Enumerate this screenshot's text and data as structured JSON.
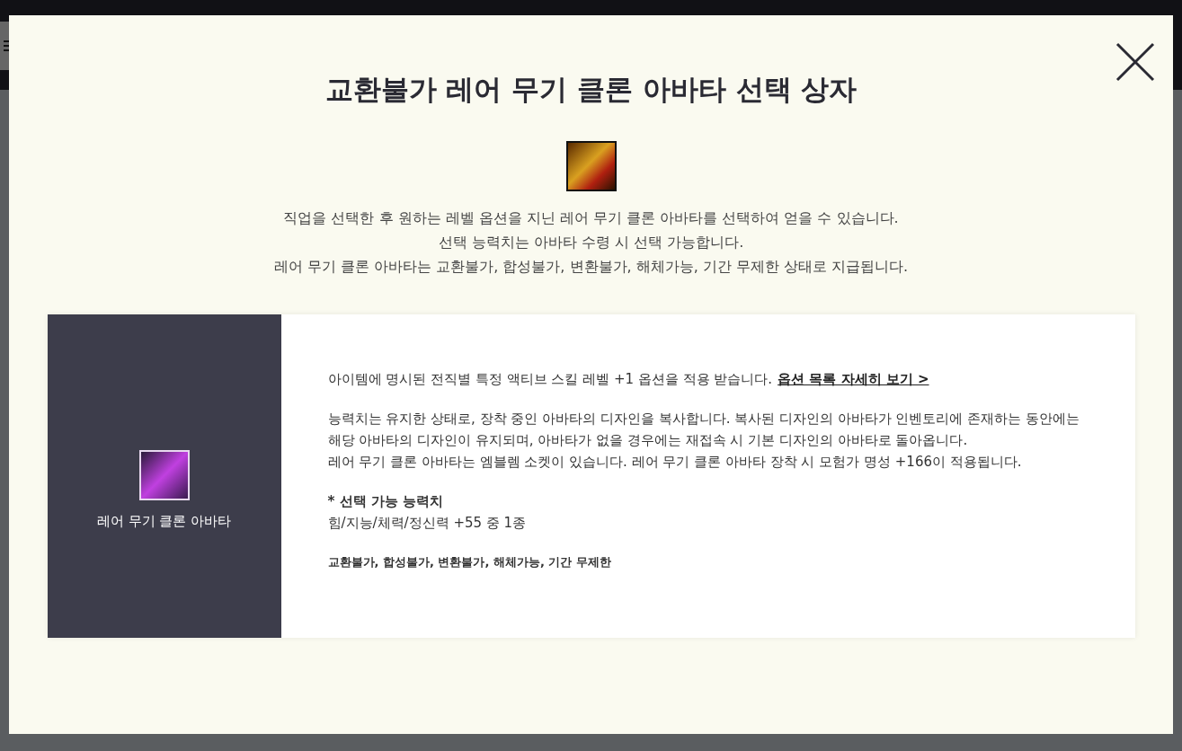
{
  "modal": {
    "title": "교환불가 레어 무기 클론 아바타 선택 상자",
    "description": [
      "직업을 선택한 후 원하는 레벨 옵션을 지닌 레어 무기 클론 아바타를 선택하여 얻을 수 있습니다.",
      "선택 능력치는 아바타 수령 시 선택 가능합니다.",
      "레어 무기 클론 아바타는 교환불가, 합성불가, 변환불가, 해체가능, 기간 무제한 상태로 지급됩니다."
    ],
    "item": {
      "name": "레어 무기 클론 아바타",
      "option_text": "아이템에 명시된 전직별 특정 액티브 스킬 레벨 +1 옵션을 적용 받습니다.",
      "option_link": "옵션 목록 자세히 보기 >",
      "details": [
        "능력치는 유지한 상태로, 장착 중인 아바타의 디자인을 복사합니다. 복사된 디자인의 아바타가 인벤토리에 존재하는 동안에는 해당 아바타의 디자인이 유지되며, 아바타가 없을 경우에는 재접속 시 기본 디자인의 아바타로 돌아옵니다.",
        "레어 무기 클론 아바타는 엠블렘 소켓이 있습니다. 레어 무기 클론 아바타 장착 시 모험가 명성 +166이 적용됩니다."
      ],
      "stats_heading": "* 선택 가능 능력치",
      "stats": "힘/지능/체력/정신력 +55 중 1종",
      "tags": "교환불가, 합성불가, 변환불가, 해체가능, 기간 무제한"
    }
  }
}
